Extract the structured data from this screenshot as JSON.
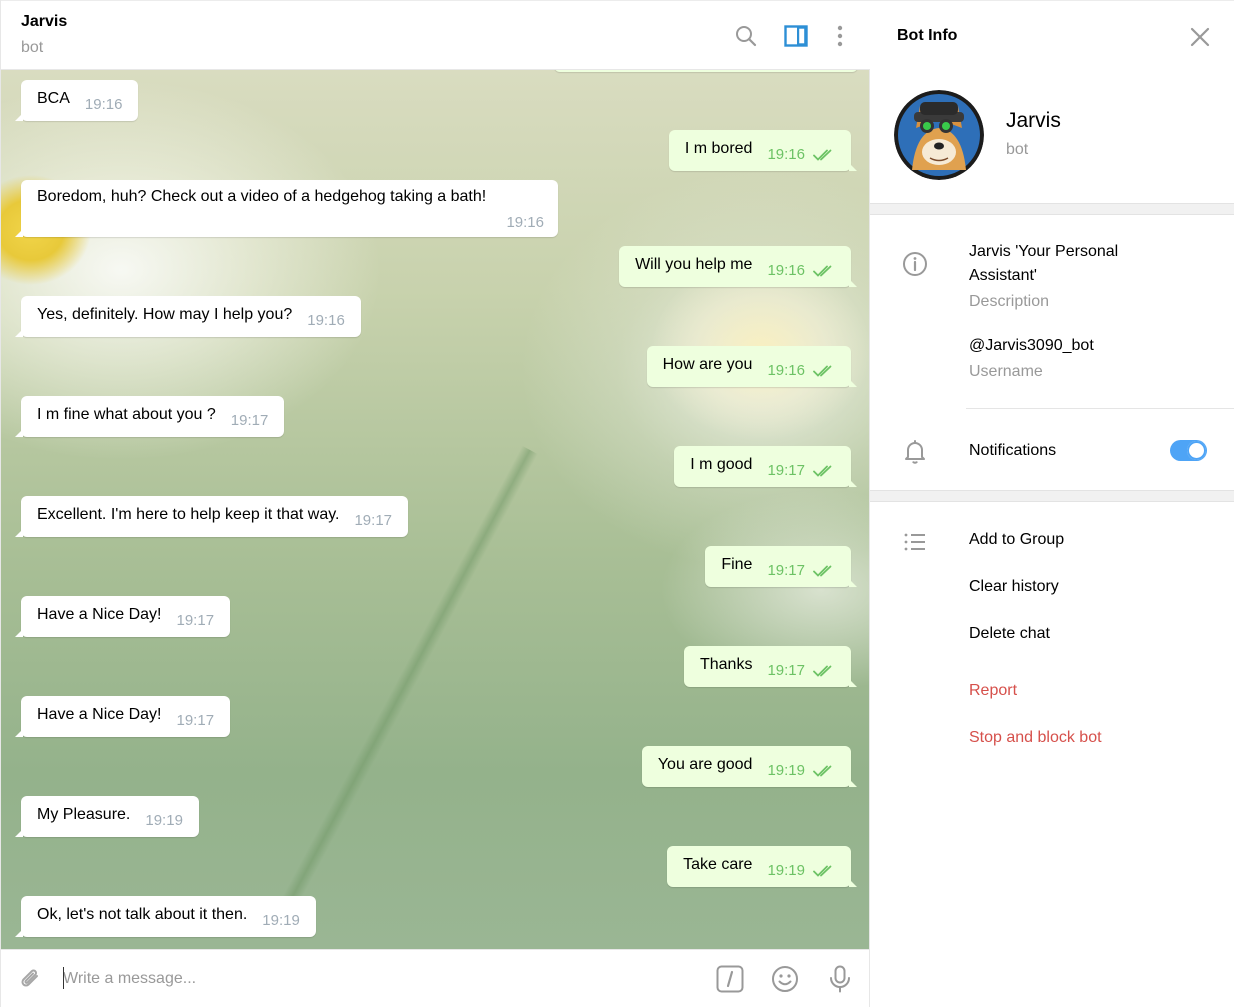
{
  "chat": {
    "title": "Jarvis",
    "subtitle": "bot",
    "messages": [
      {
        "dir": "in",
        "text": "BCA",
        "time": "19:16"
      },
      {
        "dir": "out",
        "text": "I m bored",
        "time": "19:16"
      },
      {
        "dir": "in",
        "text": "Boredom, huh? Check out a video of a hedgehog taking a bath!",
        "time": "19:16"
      },
      {
        "dir": "out",
        "text": "Will you help me",
        "time": "19:16"
      },
      {
        "dir": "in",
        "text": "Yes, definitely. How may I help you?",
        "time": "19:16"
      },
      {
        "dir": "out",
        "text": "How are you",
        "time": "19:16"
      },
      {
        "dir": "in",
        "text": "I m fine what about you ?",
        "time": "19:17"
      },
      {
        "dir": "out",
        "text": "I m good",
        "time": "19:17"
      },
      {
        "dir": "in",
        "text": "Excellent. I'm here to help keep it that way.",
        "time": "19:17"
      },
      {
        "dir": "out",
        "text": "Fine",
        "time": "19:17"
      },
      {
        "dir": "in",
        "text": "Have a Nice Day!",
        "time": "19:17"
      },
      {
        "dir": "out",
        "text": "Thanks",
        "time": "19:17"
      },
      {
        "dir": "in",
        "text": "Have a Nice Day!",
        "time": "19:17"
      },
      {
        "dir": "out",
        "text": "You are good",
        "time": "19:19"
      },
      {
        "dir": "in",
        "text": "My Pleasure.",
        "time": "19:19"
      },
      {
        "dir": "out",
        "text": "Take care",
        "time": "19:19"
      },
      {
        "dir": "in",
        "text": "Ok, let's not talk about it then.",
        "time": "19:19"
      }
    ]
  },
  "composer": {
    "placeholder": "Write a message..."
  },
  "info": {
    "title": "Bot Info",
    "name": "Jarvis",
    "status": "bot",
    "description": "Jarvis 'Your Personal Assistant'",
    "description_label": "Description",
    "username": "@Jarvis3090_bot",
    "username_label": "Username",
    "notifications_label": "Notifications",
    "notifications_on": true,
    "actions": {
      "add_to_group": "Add to Group",
      "clear_history": "Clear history",
      "delete_chat": "Delete chat",
      "report": "Report",
      "stop_and_block": "Stop and block bot"
    }
  },
  "colors": {
    "accent": "#4ea4f6",
    "outgoing_bubble": "#eeffde",
    "read_ticks": "#6cc264",
    "danger": "#d6504b"
  }
}
